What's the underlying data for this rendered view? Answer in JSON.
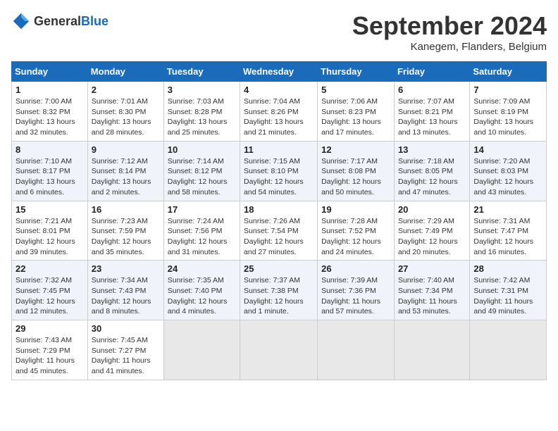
{
  "header": {
    "logo_general": "General",
    "logo_blue": "Blue",
    "title": "September 2024",
    "location": "Kanegem, Flanders, Belgium"
  },
  "days_of_week": [
    "Sunday",
    "Monday",
    "Tuesday",
    "Wednesday",
    "Thursday",
    "Friday",
    "Saturday"
  ],
  "weeks": [
    [
      {
        "day": "1",
        "lines": [
          "Sunrise: 7:00 AM",
          "Sunset: 8:32 PM",
          "Daylight: 13 hours",
          "and 32 minutes."
        ]
      },
      {
        "day": "2",
        "lines": [
          "Sunrise: 7:01 AM",
          "Sunset: 8:30 PM",
          "Daylight: 13 hours",
          "and 28 minutes."
        ]
      },
      {
        "day": "3",
        "lines": [
          "Sunrise: 7:03 AM",
          "Sunset: 8:28 PM",
          "Daylight: 13 hours",
          "and 25 minutes."
        ]
      },
      {
        "day": "4",
        "lines": [
          "Sunrise: 7:04 AM",
          "Sunset: 8:26 PM",
          "Daylight: 13 hours",
          "and 21 minutes."
        ]
      },
      {
        "day": "5",
        "lines": [
          "Sunrise: 7:06 AM",
          "Sunset: 8:23 PM",
          "Daylight: 13 hours",
          "and 17 minutes."
        ]
      },
      {
        "day": "6",
        "lines": [
          "Sunrise: 7:07 AM",
          "Sunset: 8:21 PM",
          "Daylight: 13 hours",
          "and 13 minutes."
        ]
      },
      {
        "day": "7",
        "lines": [
          "Sunrise: 7:09 AM",
          "Sunset: 8:19 PM",
          "Daylight: 13 hours",
          "and 10 minutes."
        ]
      }
    ],
    [
      {
        "day": "8",
        "lines": [
          "Sunrise: 7:10 AM",
          "Sunset: 8:17 PM",
          "Daylight: 13 hours",
          "and 6 minutes."
        ]
      },
      {
        "day": "9",
        "lines": [
          "Sunrise: 7:12 AM",
          "Sunset: 8:14 PM",
          "Daylight: 13 hours",
          "and 2 minutes."
        ]
      },
      {
        "day": "10",
        "lines": [
          "Sunrise: 7:14 AM",
          "Sunset: 8:12 PM",
          "Daylight: 12 hours",
          "and 58 minutes."
        ]
      },
      {
        "day": "11",
        "lines": [
          "Sunrise: 7:15 AM",
          "Sunset: 8:10 PM",
          "Daylight: 12 hours",
          "and 54 minutes."
        ]
      },
      {
        "day": "12",
        "lines": [
          "Sunrise: 7:17 AM",
          "Sunset: 8:08 PM",
          "Daylight: 12 hours",
          "and 50 minutes."
        ]
      },
      {
        "day": "13",
        "lines": [
          "Sunrise: 7:18 AM",
          "Sunset: 8:05 PM",
          "Daylight: 12 hours",
          "and 47 minutes."
        ]
      },
      {
        "day": "14",
        "lines": [
          "Sunrise: 7:20 AM",
          "Sunset: 8:03 PM",
          "Daylight: 12 hours",
          "and 43 minutes."
        ]
      }
    ],
    [
      {
        "day": "15",
        "lines": [
          "Sunrise: 7:21 AM",
          "Sunset: 8:01 PM",
          "Daylight: 12 hours",
          "and 39 minutes."
        ]
      },
      {
        "day": "16",
        "lines": [
          "Sunrise: 7:23 AM",
          "Sunset: 7:59 PM",
          "Daylight: 12 hours",
          "and 35 minutes."
        ]
      },
      {
        "day": "17",
        "lines": [
          "Sunrise: 7:24 AM",
          "Sunset: 7:56 PM",
          "Daylight: 12 hours",
          "and 31 minutes."
        ]
      },
      {
        "day": "18",
        "lines": [
          "Sunrise: 7:26 AM",
          "Sunset: 7:54 PM",
          "Daylight: 12 hours",
          "and 27 minutes."
        ]
      },
      {
        "day": "19",
        "lines": [
          "Sunrise: 7:28 AM",
          "Sunset: 7:52 PM",
          "Daylight: 12 hours",
          "and 24 minutes."
        ]
      },
      {
        "day": "20",
        "lines": [
          "Sunrise: 7:29 AM",
          "Sunset: 7:49 PM",
          "Daylight: 12 hours",
          "and 20 minutes."
        ]
      },
      {
        "day": "21",
        "lines": [
          "Sunrise: 7:31 AM",
          "Sunset: 7:47 PM",
          "Daylight: 12 hours",
          "and 16 minutes."
        ]
      }
    ],
    [
      {
        "day": "22",
        "lines": [
          "Sunrise: 7:32 AM",
          "Sunset: 7:45 PM",
          "Daylight: 12 hours",
          "and 12 minutes."
        ]
      },
      {
        "day": "23",
        "lines": [
          "Sunrise: 7:34 AM",
          "Sunset: 7:43 PM",
          "Daylight: 12 hours",
          "and 8 minutes."
        ]
      },
      {
        "day": "24",
        "lines": [
          "Sunrise: 7:35 AM",
          "Sunset: 7:40 PM",
          "Daylight: 12 hours",
          "and 4 minutes."
        ]
      },
      {
        "day": "25",
        "lines": [
          "Sunrise: 7:37 AM",
          "Sunset: 7:38 PM",
          "Daylight: 12 hours",
          "and 1 minute."
        ]
      },
      {
        "day": "26",
        "lines": [
          "Sunrise: 7:39 AM",
          "Sunset: 7:36 PM",
          "Daylight: 11 hours",
          "and 57 minutes."
        ]
      },
      {
        "day": "27",
        "lines": [
          "Sunrise: 7:40 AM",
          "Sunset: 7:34 PM",
          "Daylight: 11 hours",
          "and 53 minutes."
        ]
      },
      {
        "day": "28",
        "lines": [
          "Sunrise: 7:42 AM",
          "Sunset: 7:31 PM",
          "Daylight: 11 hours",
          "and 49 minutes."
        ]
      }
    ],
    [
      {
        "day": "29",
        "lines": [
          "Sunrise: 7:43 AM",
          "Sunset: 7:29 PM",
          "Daylight: 11 hours",
          "and 45 minutes."
        ]
      },
      {
        "day": "30",
        "lines": [
          "Sunrise: 7:45 AM",
          "Sunset: 7:27 PM",
          "Daylight: 11 hours",
          "and 41 minutes."
        ]
      },
      null,
      null,
      null,
      null,
      null
    ]
  ]
}
